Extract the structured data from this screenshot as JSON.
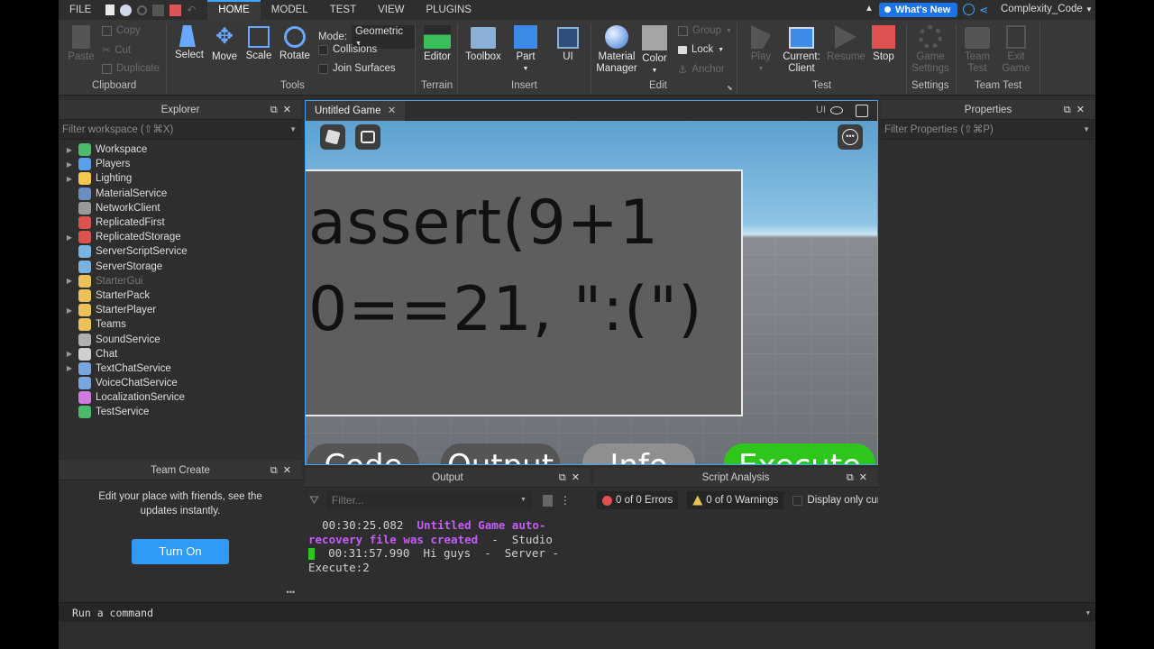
{
  "menu": {
    "file": "FILE",
    "tabs": [
      "HOME",
      "MODEL",
      "TEST",
      "VIEW",
      "PLUGINS"
    ],
    "whats_new": "What's New",
    "account": "Complexity_Code"
  },
  "ribbon": {
    "clipboard": {
      "paste": "Paste",
      "copy": "Copy",
      "cut": "Cut",
      "duplicate": "Duplicate",
      "label": "Clipboard"
    },
    "tools": {
      "select": "Select",
      "move": "Move",
      "scale": "Scale",
      "rotate": "Rotate",
      "mode_label": "Mode:",
      "mode_value": "Geometric",
      "collisions": "Collisions",
      "join_surfaces": "Join Surfaces",
      "label": "Tools"
    },
    "terrain": {
      "editor": "Editor",
      "label": "Terrain"
    },
    "insert": {
      "toolbox": "Toolbox",
      "part": "Part",
      "ui": "UI",
      "label": "Insert"
    },
    "edit": {
      "material_manager": "Material Manager",
      "color": "Color",
      "group": "Group",
      "lock": "Lock",
      "anchor": "Anchor",
      "label": "Edit"
    },
    "test": {
      "play": "Play",
      "current_client": "Current: Client",
      "resume": "Resume",
      "stop": "Stop",
      "label": "Test"
    },
    "settings": {
      "game_settings": "Game Settings",
      "label": "Settings"
    },
    "team_test": {
      "team_test": "Team Test",
      "exit_game": "Exit Game",
      "label": "Team Test"
    }
  },
  "explorer": {
    "title": "Explorer",
    "filter_placeholder": "Filter workspace (⇧⌘X)",
    "items": [
      {
        "label": "Workspace",
        "icon": "globe-icon",
        "color": "#4cb86b",
        "expandable": true
      },
      {
        "label": "Players",
        "icon": "players-icon",
        "color": "#5aa0e8",
        "expandable": true
      },
      {
        "label": "Lighting",
        "icon": "lightbulb-icon",
        "color": "#f2c94c",
        "expandable": true
      },
      {
        "label": "MaterialService",
        "icon": "material-icon",
        "color": "#6c8ebf",
        "expandable": false
      },
      {
        "label": "NetworkClient",
        "icon": "network-icon",
        "color": "#9a9a9a",
        "expandable": false
      },
      {
        "label": "ReplicatedFirst",
        "icon": "replicated-icon",
        "color": "#d9534f",
        "expandable": false
      },
      {
        "label": "ReplicatedStorage",
        "icon": "replicated-storage-icon",
        "color": "#d9534f",
        "expandable": true
      },
      {
        "label": "ServerScriptService",
        "icon": "server-script-icon",
        "color": "#7bb3e0",
        "expandable": false
      },
      {
        "label": "ServerStorage",
        "icon": "server-storage-icon",
        "color": "#7bb3e0",
        "expandable": false
      },
      {
        "label": "StarterGui",
        "icon": "folder-icon",
        "color": "#e8c15a",
        "expandable": true,
        "dim": true
      },
      {
        "label": "StarterPack",
        "icon": "folder-icon",
        "color": "#e8c15a",
        "expandable": false
      },
      {
        "label": "StarterPlayer",
        "icon": "folder-icon",
        "color": "#e8c15a",
        "expandable": true
      },
      {
        "label": "Teams",
        "icon": "teams-icon",
        "color": "#e8c15a",
        "expandable": false
      },
      {
        "label": "SoundService",
        "icon": "sound-icon",
        "color": "#b0b0b0",
        "expandable": false
      },
      {
        "label": "Chat",
        "icon": "chat-icon",
        "color": "#d0d0d0",
        "expandable": true
      },
      {
        "label": "TextChatService",
        "icon": "text-chat-icon",
        "color": "#7aa6e0",
        "expandable": true
      },
      {
        "label": "VoiceChatService",
        "icon": "voice-chat-icon",
        "color": "#7aa6e0",
        "expandable": false
      },
      {
        "label": "LocalizationService",
        "icon": "localization-icon",
        "color": "#d07be0",
        "expandable": false
      },
      {
        "label": "TestService",
        "icon": "check-icon",
        "color": "#4cb86b",
        "expandable": false
      }
    ]
  },
  "team_create": {
    "title": "Team Create",
    "message": "Edit your place with friends, see the updates instantly.",
    "button": "Turn On",
    "more": "•••"
  },
  "viewport": {
    "tab": "Untitled Game",
    "ui_label": "UI",
    "code_lines": [
      "assert(9+1",
      "0==21, \":(\")"
    ],
    "buttons": [
      "Code",
      "Output",
      "Info",
      "Execute"
    ]
  },
  "output": {
    "title": "Output",
    "filter_placeholder": "Filter...",
    "lines": [
      {
        "time": "00:30:25.082",
        "msg": "Untitled Game auto-recovery file was created",
        "source": "Studio"
      },
      {
        "time": "00:31:57.990",
        "msg": "Hi guys",
        "source": "Server - Execute:2"
      }
    ]
  },
  "script_analysis": {
    "title": "Script Analysis",
    "errors": "0 of 0 Errors",
    "warnings": "0 of 0 Warnings",
    "display_only": "Display only curre"
  },
  "properties": {
    "title": "Properties",
    "filter_placeholder": "Filter Properties (⇧⌘P)"
  },
  "command": {
    "placeholder": "Run a command"
  }
}
